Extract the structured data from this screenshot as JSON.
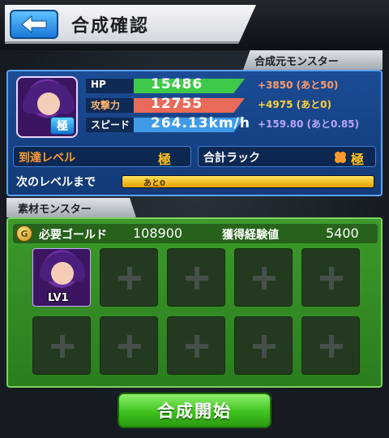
{
  "header": {
    "title": "合成確認"
  },
  "source": {
    "tag": "合成元モンスター",
    "rank_badge": "極",
    "stats": [
      {
        "label": "HP",
        "value": "15486",
        "gain": "+3850 (あと50)",
        "label_color": "#ffffff",
        "gain_color": "#ff9b6a"
      },
      {
        "label": "攻撃力",
        "value": "12755",
        "gain": "+4975 (あと0)",
        "label_color": "#ffb36a",
        "gain_color": "#ffd23a"
      },
      {
        "label": "スピード",
        "value": "264.13km/h",
        "gain": "+159.80 (あと0.85)",
        "label_color": "#ffffff",
        "gain_color": "#b9a6ff"
      }
    ],
    "reach_level": {
      "label": "到達レベル",
      "value": "極"
    },
    "total_luck": {
      "label": "合計ラック",
      "value": "極",
      "icon": "clover-icon"
    },
    "next_level": {
      "label": "次のレベルまで",
      "remaining": "あと0",
      "progress": 1.0
    }
  },
  "material": {
    "tag": "素材モンスター",
    "gold_label": "必要ゴールド",
    "gold_value": "108900",
    "exp_label": "獲得経験値",
    "exp_value": "5400",
    "slots": [
      {
        "filled": true,
        "level": "LV1"
      },
      {
        "filled": false
      },
      {
        "filled": false
      },
      {
        "filled": false
      },
      {
        "filled": false
      },
      {
        "filled": false
      },
      {
        "filled": false
      },
      {
        "filled": false
      },
      {
        "filled": false
      },
      {
        "filled": false
      }
    ]
  },
  "start_button": "合成開始",
  "colors": {
    "source_panel": "#1b4c95",
    "material_panel": "#3d9a2b",
    "accent_gold": "#ffc21c",
    "start_button": "#3ec21f"
  }
}
